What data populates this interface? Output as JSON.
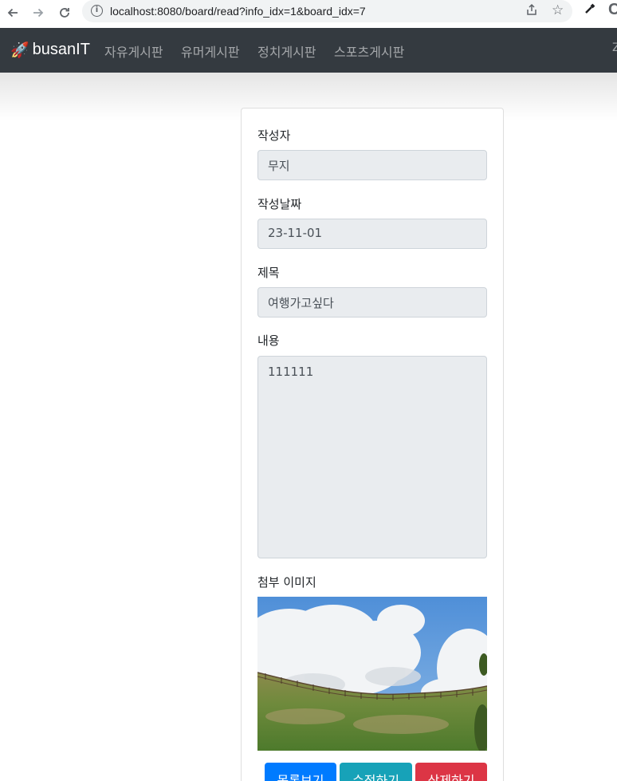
{
  "browser": {
    "back_icon": "arrow-left-icon",
    "forward_icon": "arrow-right-icon",
    "reload_icon": "reload-icon",
    "url": "localhost:8080/board/read?info_idx=1&board_idx=7",
    "profile_partial": "C"
  },
  "navbar": {
    "brand_icon": "🚀",
    "brand": "busanIT",
    "links": [
      "자유게시판",
      "유머게시판",
      "정치게시판",
      "스포츠게시판"
    ],
    "right_partial": "Z"
  },
  "post": {
    "author_label": "작성자",
    "author": "무지",
    "date_label": "작성날짜",
    "date": "23-11-01",
    "title_label": "제목",
    "title": "여행가고싶다",
    "content_label": "내용",
    "content": "111111",
    "image_label": "첨부 이미지"
  },
  "buttons": {
    "list": "목록보기",
    "edit": "수정하기",
    "delete": "삭제하기"
  },
  "colors": {
    "navbar": "#343a40",
    "primary": "#007bff",
    "info": "#17a2b8",
    "danger": "#dc3545",
    "readonly_field": "#e9ecef"
  }
}
